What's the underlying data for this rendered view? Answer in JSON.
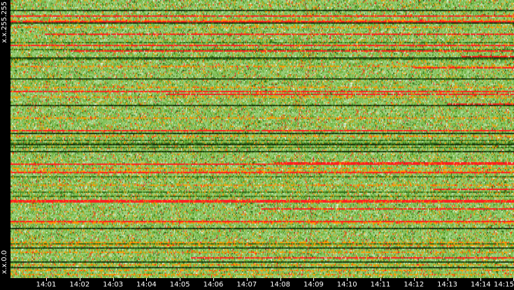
{
  "y_axis": {
    "top_label": "x.x.255.255",
    "bottom_label": "x.x.0.0"
  },
  "x_axis": {
    "ticks": [
      "14:01",
      "14:02",
      "14:03",
      "14:04",
      "14:05",
      "14:06",
      "14:07",
      "14:08",
      "14:09",
      "14:10",
      "14:11",
      "14:12",
      "14:13",
      "14:14",
      "14:15"
    ]
  },
  "colors": {
    "light_green": "#9ccf7c",
    "green": "#6fb43c",
    "dark_green": "#2f6a18",
    "orange": "#ff9a00",
    "red": "#ff1f1f",
    "white": "#e6f2dc",
    "black_row": "#17300c"
  }
}
